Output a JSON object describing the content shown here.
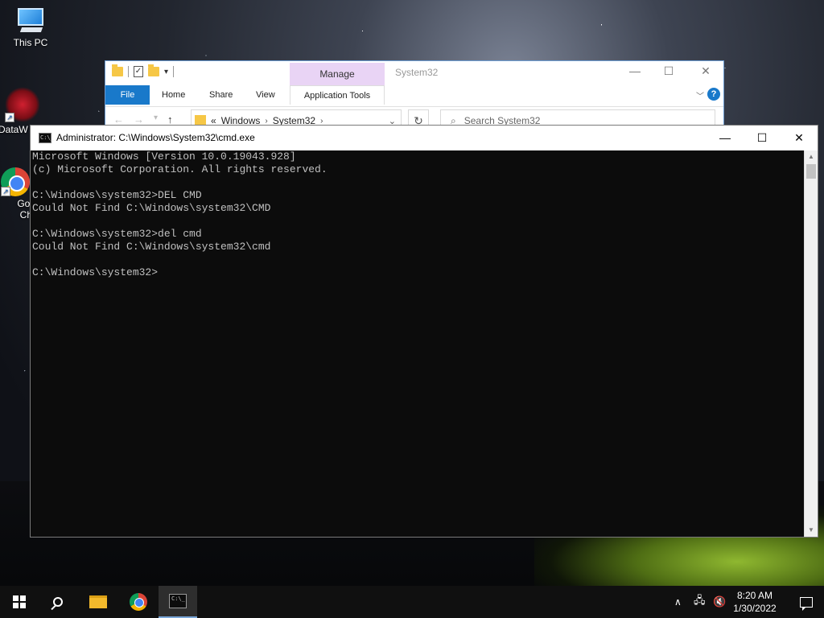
{
  "desktop": {
    "icons": [
      {
        "label": "This PC",
        "icon": "computer-icon"
      },
      {
        "label": "DataW",
        "icon": "datawarehouse-icon"
      },
      {
        "label": "Goo\nChr",
        "icon": "chrome-icon"
      }
    ]
  },
  "explorer": {
    "title": "System32",
    "manage_tab": "Manage",
    "ribbon_tabs": [
      "File",
      "Home",
      "Share",
      "View",
      "Application Tools"
    ],
    "breadcrumb": [
      "«",
      "Windows",
      "System32"
    ],
    "search_placeholder": "Search System32",
    "help_glyph": "?"
  },
  "cmd": {
    "title": "Administrator: C:\\Windows\\System32\\cmd.exe",
    "lines": [
      "Microsoft Windows [Version 10.0.19043.928]",
      "(c) Microsoft Corporation. All rights reserved.",
      "",
      "C:\\Windows\\system32>DEL CMD",
      "Could Not Find C:\\Windows\\system32\\CMD",
      "",
      "C:\\Windows\\system32>del cmd",
      "Could Not Find C:\\Windows\\system32\\cmd",
      "",
      "C:\\Windows\\system32>"
    ],
    "background": "#0c0c0c",
    "foreground": "#c0c0c0"
  },
  "taskbar": {
    "clock_time": "8:20 AM",
    "clock_date": "1/30/2022",
    "pinned": [
      "start-icon",
      "search-icon",
      "file-explorer-icon",
      "chrome-icon",
      "command-prompt-icon"
    ],
    "active": "command-prompt-icon"
  }
}
